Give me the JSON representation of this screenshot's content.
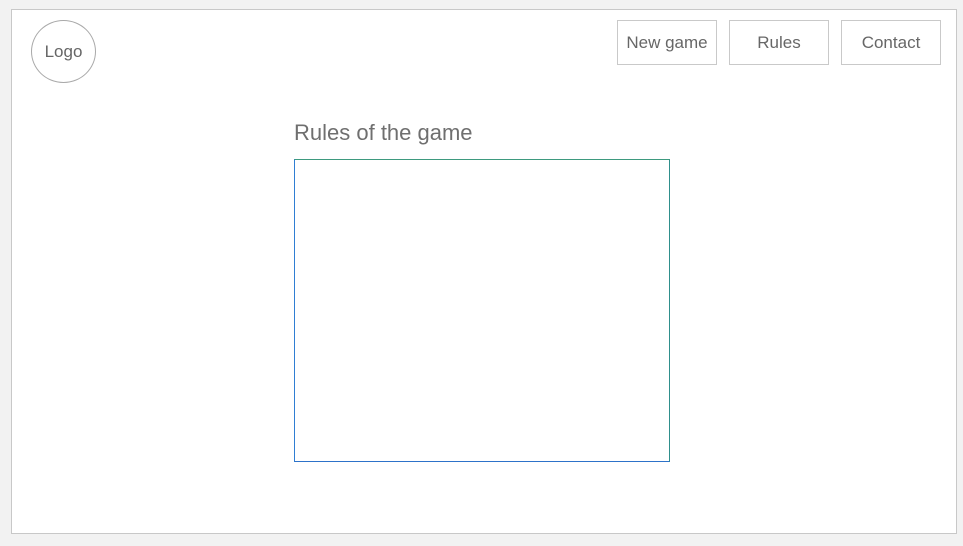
{
  "header": {
    "logo_text": "Logo",
    "nav": {
      "new_game": "New game",
      "rules": "Rules",
      "contact": "Contact"
    }
  },
  "main": {
    "title": "Rules of the game",
    "rules_text": ""
  }
}
